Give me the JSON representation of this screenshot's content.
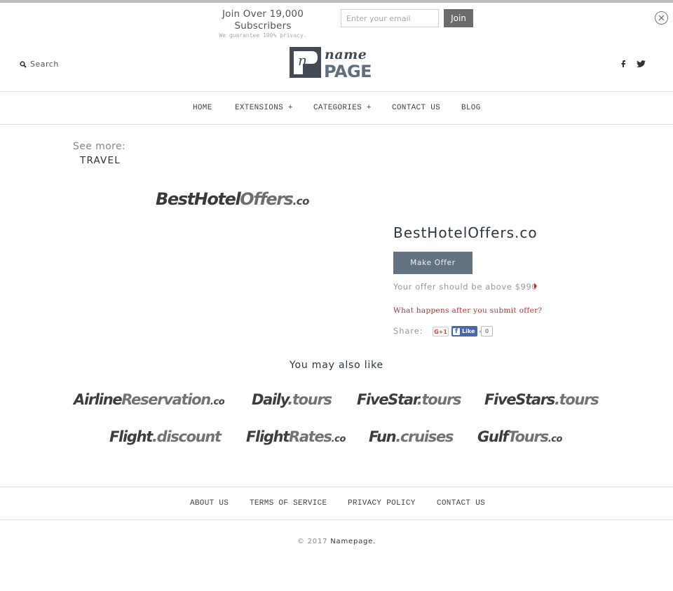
{
  "subscribe": {
    "title": "Join Over 19,000 Subscribers",
    "note": "We guarantee 100% privacy.",
    "email_placeholder": "Enter your email",
    "email_value": "",
    "join_label": "Join",
    "close_icon": "close-circle-icon"
  },
  "header": {
    "search_label": "Search",
    "search_icon": "search-icon",
    "logo": {
      "top": "name",
      "bottom": "PAGE",
      "mark": "n"
    },
    "social": [
      {
        "name": "facebook",
        "glyph": "f"
      },
      {
        "name": "twitter",
        "glyph": "twitter-bird"
      }
    ]
  },
  "nav": {
    "items": [
      {
        "label": "HOME"
      },
      {
        "label": "EXTENSIONS +"
      },
      {
        "label": "CATEGORIES +"
      },
      {
        "label": "CONTACT US"
      },
      {
        "label": "BLOG"
      }
    ]
  },
  "see_more": {
    "label": "See more:",
    "category": "TRAVEL"
  },
  "product": {
    "logo_parts": {
      "dark": "BestHotel",
      "light": "Offers",
      "ext": ".co"
    },
    "title": "BestHotelOffers.co",
    "make_offer_label": "Make Offer",
    "offer_hint": "Your offer should be above $990",
    "what_happens_link": "What happens after you submit offer?",
    "share_label": "Share:",
    "gplus_label": "G+1",
    "fb_like_label": "Like",
    "fb_like_count": "0"
  },
  "related": {
    "title": "You may also like",
    "items": [
      {
        "dark": "Airline",
        "light": "Reservation",
        "ext": ".co"
      },
      {
        "dark": "Daily",
        "light": ".tours",
        "ext": ""
      },
      {
        "dark": "FiveStar",
        "light": ".tours",
        "ext": ""
      },
      {
        "dark": "FiveStars",
        "light": ".tours",
        "ext": ""
      },
      {
        "dark": "Flight",
        "light": ".discount",
        "ext": ""
      },
      {
        "dark": "Flight",
        "light": "Rates",
        "ext": ".co"
      },
      {
        "dark": "Fun",
        "light": ".cruises",
        "ext": ""
      },
      {
        "dark": "Gulf",
        "light": "Tours",
        "ext": ".co"
      }
    ]
  },
  "footer": {
    "links": [
      {
        "label": "ABOUT US"
      },
      {
        "label": "TERMS OF SERVICE"
      },
      {
        "label": "PRIVACY POLICY"
      },
      {
        "label": "CONTACT US"
      }
    ],
    "copyright_prefix": "© 2017",
    "copyright_link": "Namepage."
  },
  "colors": {
    "button_slate": "#647382",
    "join_button": "#6b6b6b",
    "link_red": "#a8323a",
    "facebook_blue": "#4a66ad",
    "title_dark": "#2c3640"
  }
}
